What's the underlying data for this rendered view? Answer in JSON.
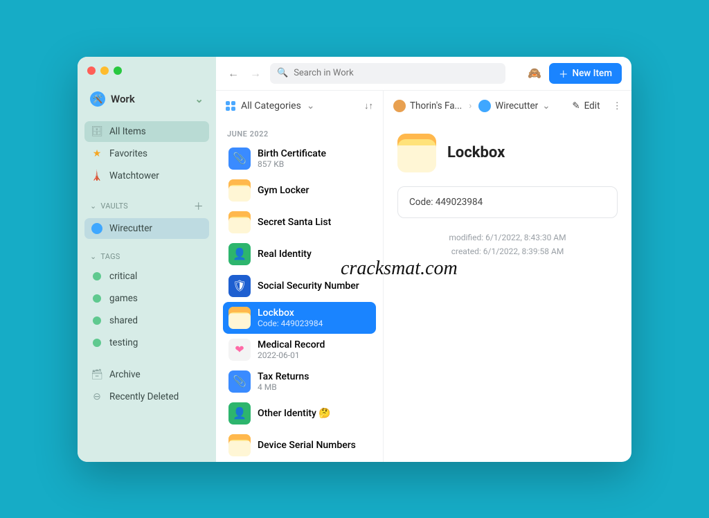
{
  "sidebar": {
    "vault_name": "Work",
    "nav": [
      {
        "label": "All Items"
      },
      {
        "label": "Favorites"
      },
      {
        "label": "Watchtower"
      }
    ],
    "vaults_header": "VAULTS",
    "vaults": [
      {
        "label": "Wirecutter"
      }
    ],
    "tags_header": "TAGS",
    "tags": [
      {
        "label": "critical"
      },
      {
        "label": "games"
      },
      {
        "label": "shared"
      },
      {
        "label": "testing"
      }
    ],
    "archive": "Archive",
    "deleted": "Recently Deleted"
  },
  "toolbar": {
    "search_placeholder": "Search in Work",
    "new_item": "New Item"
  },
  "list": {
    "filter_label": "All Categories",
    "group": "JUNE 2022",
    "items": [
      {
        "title": "Birth Certificate",
        "sub": "857 KB",
        "icon": "blue"
      },
      {
        "title": "Gym Locker",
        "sub": "",
        "icon": "note"
      },
      {
        "title": "Secret Santa List",
        "sub": "",
        "icon": "note"
      },
      {
        "title": "Real Identity",
        "sub": "",
        "icon": "id"
      },
      {
        "title": "Social Security Number",
        "sub": "",
        "icon": "shield"
      },
      {
        "title": "Lockbox",
        "sub": "Code: 449023984",
        "icon": "note"
      },
      {
        "title": "Medical Record",
        "sub": "2022-06-01",
        "icon": "med"
      },
      {
        "title": "Tax Returns",
        "sub": "4 MB",
        "icon": "blue"
      },
      {
        "title": "Other Identity 🤔",
        "sub": "",
        "icon": "id"
      },
      {
        "title": "Device Serial Numbers",
        "sub": "",
        "icon": "note"
      }
    ]
  },
  "detail": {
    "family": "Thorin's Fa...",
    "vault": "Wirecutter",
    "edit": "Edit",
    "title": "Lockbox",
    "field": "Code: 449023984",
    "modified": "modified: 6/1/2022, 8:43:30 AM",
    "created": "created: 6/1/2022, 8:39:58 AM"
  },
  "watermark": "cracksmat.com"
}
